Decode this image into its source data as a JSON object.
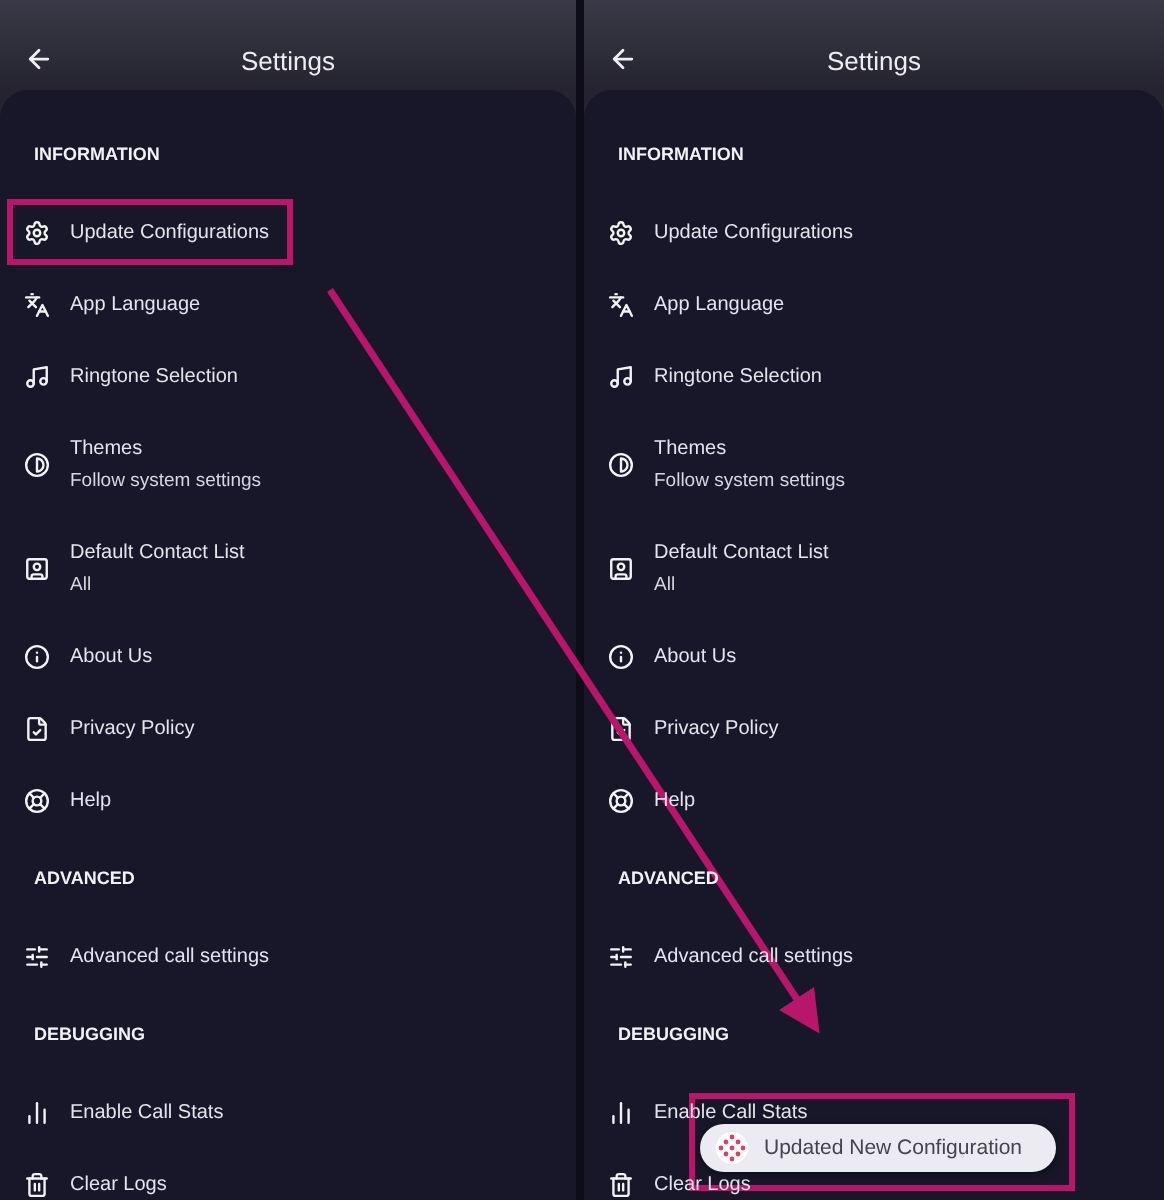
{
  "panels": [
    {
      "title": "Settings",
      "sections": [
        {
          "heading": "INFORMATION",
          "items": [
            {
              "label": "Update Configurations"
            },
            {
              "label": "App Language"
            },
            {
              "label": "Ringtone Selection"
            },
            {
              "label": "Themes",
              "value": "Follow system settings"
            },
            {
              "label": "Default Contact List",
              "value": "All"
            },
            {
              "label": "About Us"
            },
            {
              "label": "Privacy Policy"
            },
            {
              "label": "Help"
            }
          ]
        },
        {
          "heading": "ADVANCED",
          "items": [
            {
              "label": "Advanced call settings"
            }
          ]
        },
        {
          "heading": "DEBUGGING",
          "items": [
            {
              "label": "Enable Call Stats"
            },
            {
              "label": "Clear Logs"
            }
          ]
        }
      ]
    },
    {
      "title": "Settings",
      "sections": [
        {
          "heading": "INFORMATION",
          "items": [
            {
              "label": "Update Configurations"
            },
            {
              "label": "App Language"
            },
            {
              "label": "Ringtone Selection"
            },
            {
              "label": "Themes",
              "value": "Follow system settings"
            },
            {
              "label": "Default Contact List",
              "value": "All"
            },
            {
              "label": "About Us"
            },
            {
              "label": "Privacy Policy"
            },
            {
              "label": "Help"
            }
          ]
        },
        {
          "heading": "ADVANCED",
          "items": [
            {
              "label": "Advanced call settings"
            }
          ]
        },
        {
          "heading": "DEBUGGING",
          "items": [
            {
              "label": "Enable Call Stats"
            },
            {
              "label": "Clear Logs"
            }
          ]
        }
      ],
      "toast": {
        "message": "Updated New Configuration"
      }
    }
  ]
}
